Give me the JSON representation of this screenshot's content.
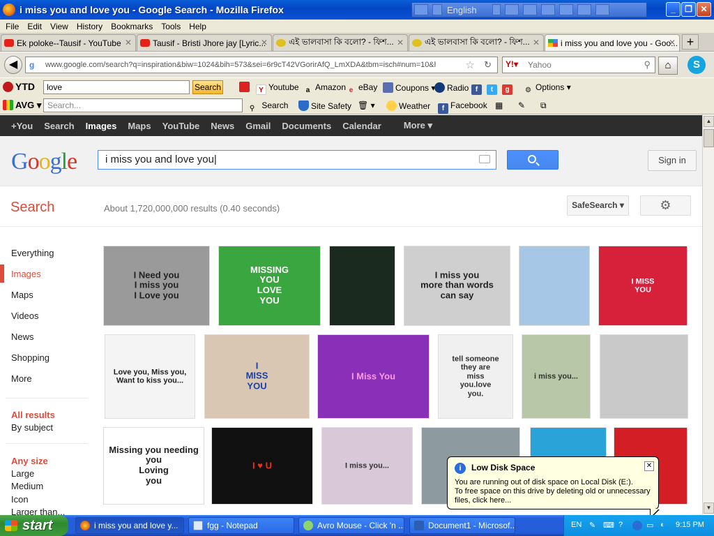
{
  "window": {
    "title": "i miss you and love you - Google Search - Mozilla Firefox",
    "lang_bar": "English"
  },
  "menu": [
    "File",
    "Edit",
    "View",
    "History",
    "Bookmarks",
    "Tools",
    "Help"
  ],
  "tabs": [
    {
      "label": "Ek poloke--Tausif - YouTube"
    },
    {
      "label": "Tausif - Bristi Jhore jay  [Lyric..."
    },
    {
      "label": "এই ভালবাসা কি বলো? - ফিশ..."
    },
    {
      "label": "এই ভালবাসা কি বলো? - ফিশ..."
    },
    {
      "label": "i miss you and love you - Goo..."
    }
  ],
  "nav": {
    "url": "www.google.com/search?q=inspiration&biw=1024&bih=573&sei=6r9cT42VGorirAfQ_LmXDA&tbm=isch#num=10&hl=en&",
    "search_placeholder": "Yahoo"
  },
  "ytd_toolbar": {
    "label": "YTD",
    "query": "love",
    "search_button": "Search",
    "links": [
      "Youtube",
      "Amazon",
      "eBay",
      "Coupons",
      "Radio",
      "Options"
    ]
  },
  "avg_toolbar": {
    "label": "AVG",
    "placeholder": "Search...",
    "search_label": "Search",
    "links": [
      "Site Safety",
      "Weather",
      "Facebook"
    ]
  },
  "google_bar": [
    "+You",
    "Search",
    "Images",
    "Maps",
    "YouTube",
    "News",
    "Gmail",
    "Documents",
    "Calendar",
    "More"
  ],
  "header": {
    "logo_letters": [
      "G",
      "o",
      "o",
      "g",
      "l",
      "e"
    ],
    "query": "i miss you and love you",
    "sign_in": "Sign in"
  },
  "results": {
    "section_title": "Search",
    "stats": "About 1,720,000,000 results (0.40 seconds)",
    "safesearch": "SafeSearch"
  },
  "left_nav": {
    "items": [
      "Everything",
      "Images",
      "Maps",
      "Videos",
      "News",
      "Shopping",
      "More"
    ],
    "filter_heading": "All results",
    "filter_option": "By subject",
    "size_heading": "Any size",
    "sizes": [
      "Large",
      "Medium",
      "Icon",
      "Larger than..."
    ]
  },
  "images": [
    {
      "caption": "I Need you\nI miss you\nI Love you",
      "bg": "#9a9a9a",
      "fg": "#222222"
    },
    {
      "caption": "MISSING\nYOU\nLOVE\nYOU",
      "bg": "#3aa640",
      "fg": "#ffffff"
    },
    {
      "caption": "",
      "bg": "#1b2a1e",
      "fg": "#cc2222"
    },
    {
      "caption": "I miss you\nmore than words\ncan say",
      "bg": "#cfcfcf",
      "fg": "#222222"
    },
    {
      "caption": "",
      "bg": "#a6c8e6",
      "fg": "#8a1010"
    },
    {
      "caption": "I MISS\nYOU",
      "bg": "#d7203a",
      "fg": "#ffffff"
    },
    {
      "caption": "Love you, Miss you,\nWant to kiss you...",
      "bg": "#f4f4f4",
      "fg": "#222222"
    },
    {
      "caption": "I\nMISS\nYOU",
      "bg": "#d9c6b3",
      "fg": "#1a3fa8"
    },
    {
      "caption": "I Miss You",
      "bg": "#8a2fb8",
      "fg": "#ff9be8"
    },
    {
      "caption": "tell someone\nthey are\nmiss\nyou.love\nyou.",
      "bg": "#f0f0f0",
      "fg": "#333333"
    },
    {
      "caption": "i miss you...",
      "bg": "#b7c7a8",
      "fg": "#333333"
    },
    {
      "caption": "",
      "bg": "#c9c9c9",
      "fg": "#222222"
    },
    {
      "caption": "Missing you needing you\nLoving\nyou",
      "bg": "#ffffff",
      "fg": "#222222"
    },
    {
      "caption": "I ♥ U",
      "bg": "#111111",
      "fg": "#e8321e"
    },
    {
      "caption": "I miss you...",
      "bg": "#d8c8d8",
      "fg": "#333333"
    },
    {
      "caption": "",
      "bg": "#8d9aa0",
      "fg": "#222222"
    },
    {
      "caption": "When",
      "bg": "#2aa3d9",
      "fg": "#ffffff"
    },
    {
      "caption": "",
      "bg": "#d41e26",
      "fg": "#ffffff"
    }
  ],
  "balloon": {
    "title": "Low Disk Space",
    "text": "You are running out of disk space on Local Disk (E:).\nTo free space on this drive by deleting old or unnecessary files, click here..."
  },
  "taskbar": {
    "start": "start",
    "tasks": [
      "i miss you and love y...",
      "fgg - Notepad",
      "Avro Mouse - Click 'n ...",
      "Document1 - Microsof..."
    ],
    "lang": "EN",
    "clock": "9:15 PM"
  }
}
